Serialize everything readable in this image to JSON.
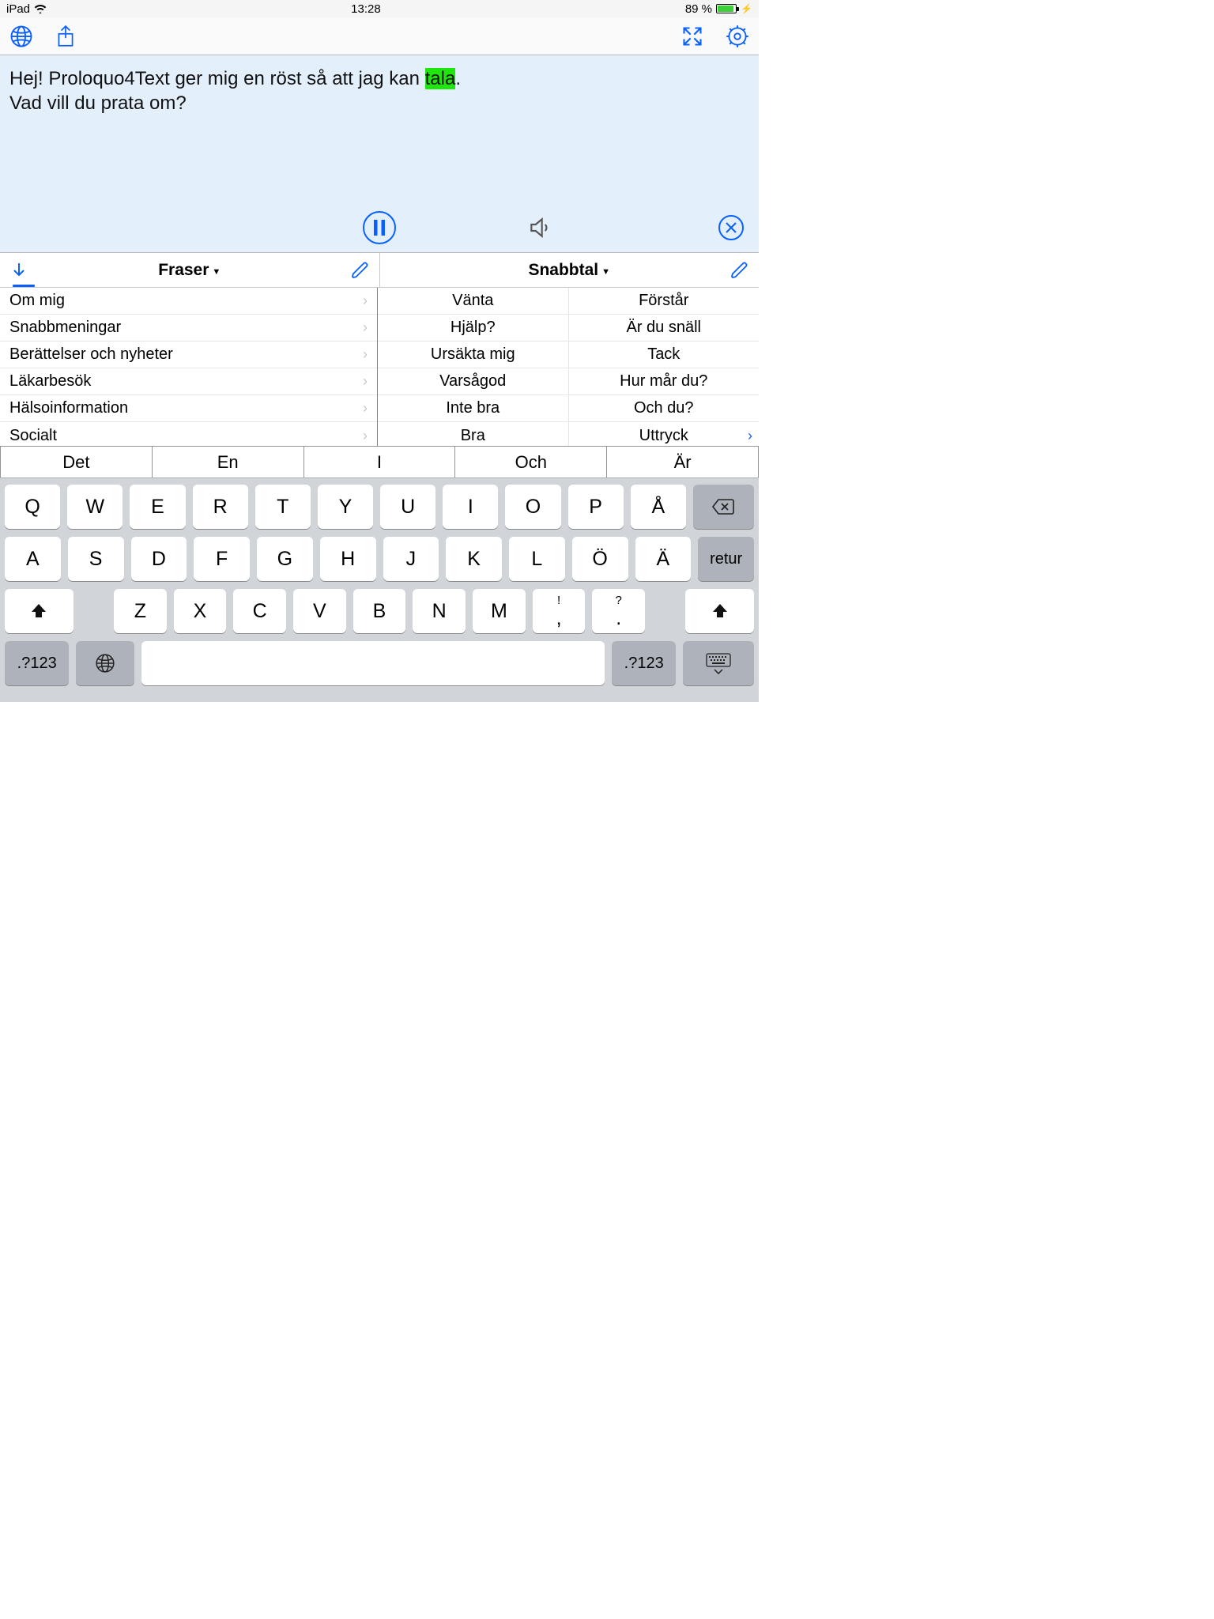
{
  "status": {
    "device": "iPad",
    "time": "13:28",
    "battery_pct": "89 %"
  },
  "text": {
    "line1_pre": "Hej! Proloquo4Text ger mig en röst så att jag kan ",
    "highlight": "tala",
    "line1_post": ".",
    "line2": "Vad vill du prata om?"
  },
  "tabs": {
    "left": "Fraser",
    "right": "Snabbtal"
  },
  "phrases": [
    "Om mig",
    "Snabbmeningar",
    "Berättelser och nyheter",
    "Läkarbesök",
    "Hälsoinformation",
    "Socialt"
  ],
  "quick": {
    "col1": [
      "Vänta",
      "Hjälp?",
      "Ursäkta mig",
      "Varsågod",
      "Inte bra",
      "Bra"
    ],
    "col2": [
      "Förstår",
      "Är du snäll",
      "Tack",
      "Hur mår du?",
      "Och du?",
      "Uttryck"
    ]
  },
  "predict": [
    "Det",
    "En",
    "I",
    "Och",
    "Är"
  ],
  "keys": {
    "row1": [
      "Q",
      "W",
      "E",
      "R",
      "T",
      "Y",
      "U",
      "I",
      "O",
      "P",
      "Å"
    ],
    "row2": [
      "A",
      "S",
      "D",
      "F",
      "G",
      "H",
      "J",
      "K",
      "L",
      "Ö",
      "Ä"
    ],
    "row3": [
      "Z",
      "X",
      "C",
      "V",
      "B",
      "N",
      "M"
    ],
    "punct1_top": "!",
    "punct1_bot": ",",
    "punct2_top": "?",
    "punct2_bot": ".",
    "return": "retur",
    "numsw": ".?123"
  }
}
